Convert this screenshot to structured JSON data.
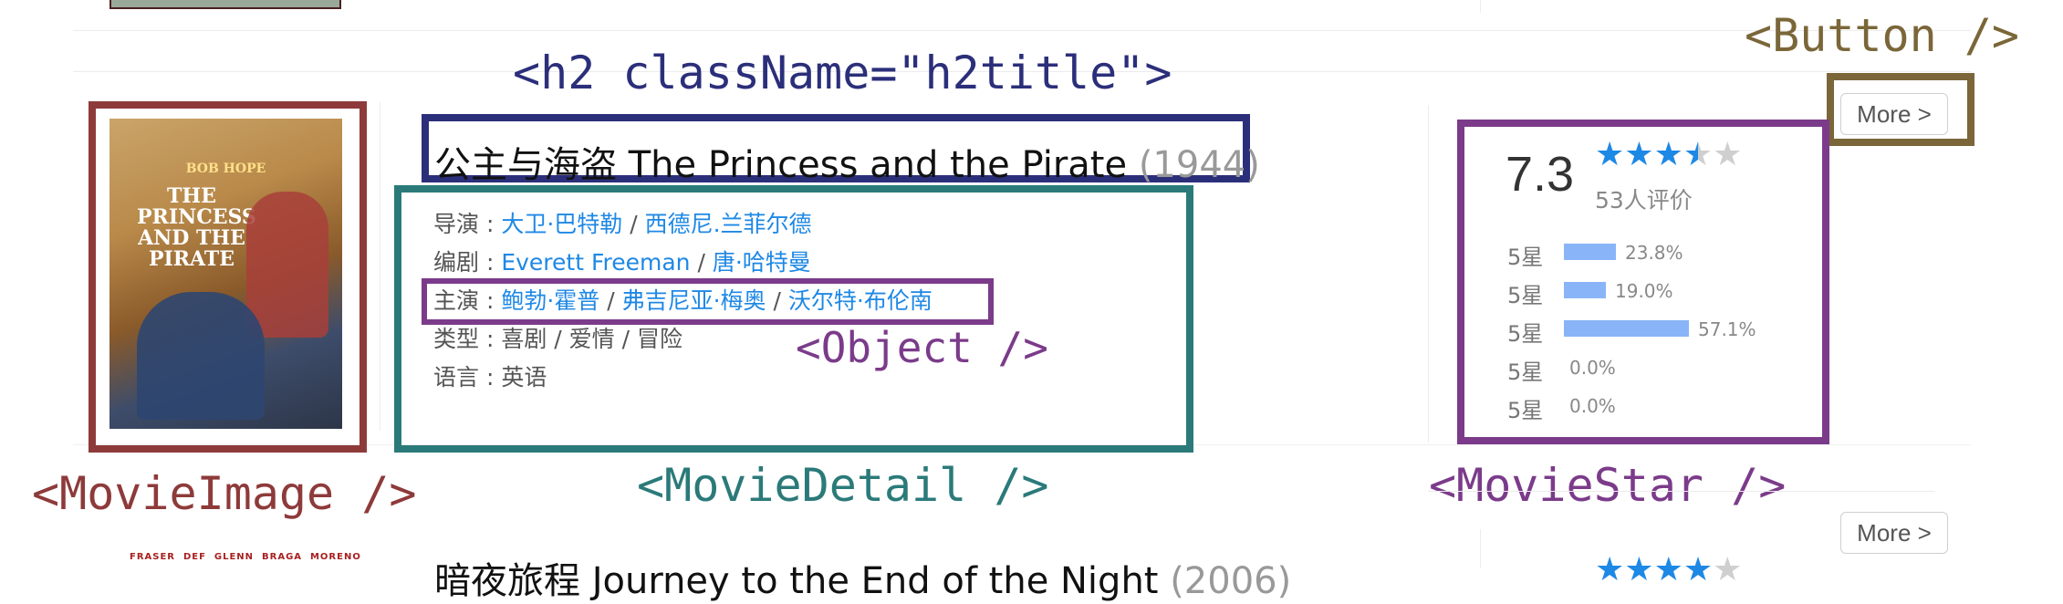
{
  "colors": {
    "movie_image_box": "#8e3a3a",
    "h2_box": "#2b2f7a",
    "movie_detail_box": "#2b7a7a",
    "object_box": "#7b3b8a",
    "movie_star_box": "#7b3b8a",
    "button_box": "#7a6638",
    "link": "#1e88e5",
    "bar": "#8ab4f8",
    "star_filled": "#1e88e5",
    "star_empty": "#cfcfcf"
  },
  "annotations": {
    "h2": "<h2 className=\"h2title\">",
    "button": "<Button />",
    "movie_image": "<MovieImage />",
    "movie_detail": "<MovieDetail />",
    "movie_star": "<MovieStar />",
    "object": "<Object />"
  },
  "movie": {
    "title": "公主与海盗 The Princess and the Pirate",
    "year": "(1944)",
    "poster_title": "THE PRINCESS AND THE PIRATE",
    "poster_actor": "BOB HOPE",
    "directors_label": "导演 : ",
    "directors": [
      "大卫·巴特勒",
      "西德尼.兰菲尔德"
    ],
    "writers_label": "编剧 : ",
    "writers": [
      "Everett Freeman",
      "唐·哈特曼"
    ],
    "actors_label": "主演 : ",
    "actors": [
      "鲍勃·霍普",
      "弗吉尼亚·梅奥",
      "沃尔特·布伦南"
    ],
    "genre_label": "类型 : ",
    "genre": "喜剧 / 爱情 / 冒险",
    "language_label": "语言 : ",
    "language": "英语",
    "separator": " / "
  },
  "rating": {
    "score": "7.3",
    "value": 3.5,
    "max": 5,
    "count": "53人评价",
    "rows": [
      {
        "label": "5星",
        "pct": "23.8%",
        "value": 23.8
      },
      {
        "label": "5星",
        "pct": "19.0%",
        "value": 19.0
      },
      {
        "label": "5星",
        "pct": "57.1%",
        "value": 57.1
      },
      {
        "label": "5星",
        "pct": "0.0%",
        "value": 0.0
      },
      {
        "label": "5星",
        "pct": "0.0%",
        "value": 0.0
      }
    ]
  },
  "buttons": {
    "more": "More >"
  },
  "next_movie": {
    "title": "暗夜旅程 Journey to the End of the Night",
    "year": "(2006)",
    "poster_credits": "FRASER  DEF  GLENN  BRAGA  MORENO"
  }
}
